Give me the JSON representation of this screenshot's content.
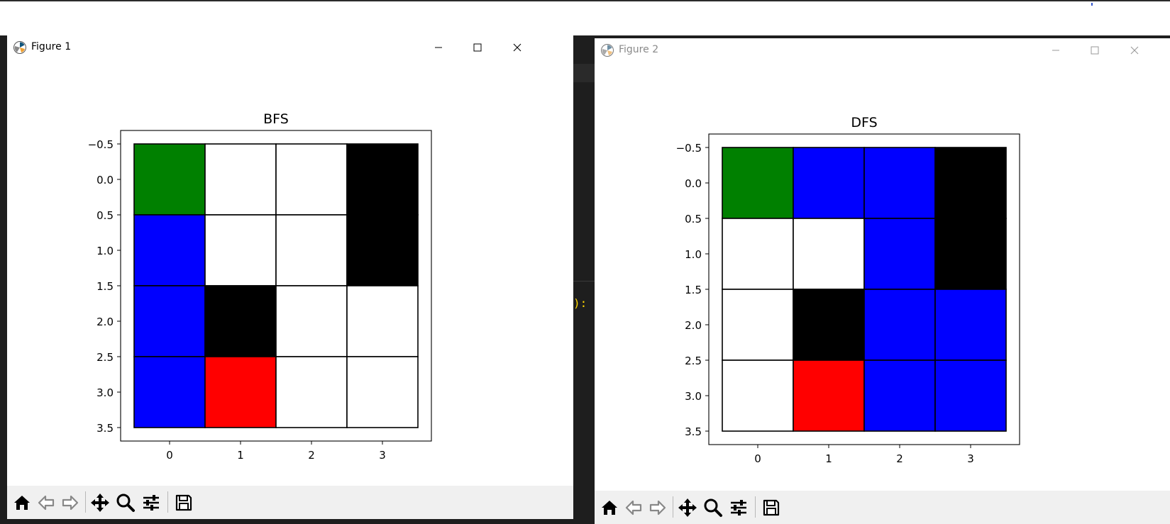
{
  "colors": {
    "start": "#008000",
    "visited": "#0000ff",
    "wall": "#000000",
    "goal": "#ff0000",
    "empty": "#ffffff"
  },
  "editor": {
    "code_fragment": "):"
  },
  "windows": [
    {
      "title": "Figure 1",
      "title_color": "#000000",
      "toolbar_buttons": [
        {
          "icon": "home-icon",
          "label": "Home"
        },
        {
          "icon": "back-arrow-icon",
          "label": "Back"
        },
        {
          "icon": "forward-arrow-icon",
          "label": "Forward"
        },
        {
          "icon": "pan-icon",
          "label": "Pan"
        },
        {
          "icon": "zoom-icon",
          "label": "Zoom"
        },
        {
          "icon": "configure-subplots-icon",
          "label": "Configure subplots"
        },
        {
          "icon": "save-icon",
          "label": "Save"
        }
      ],
      "chart_data": {
        "type": "heatmap",
        "title": "BFS",
        "xlabel": "",
        "ylabel": "",
        "x_ticks": [
          "0",
          "1",
          "2",
          "3"
        ],
        "y_ticks": [
          "−0.5",
          "0.0",
          "0.5",
          "1.0",
          "1.5",
          "2.0",
          "2.5",
          "3.0",
          "3.5"
        ],
        "xlim": [
          -0.5,
          3.5
        ],
        "ylim": [
          3.5,
          -0.5
        ],
        "grid": [
          [
            "start",
            "empty",
            "empty",
            "wall"
          ],
          [
            "visited",
            "empty",
            "empty",
            "wall"
          ],
          [
            "visited",
            "wall",
            "empty",
            "empty"
          ],
          [
            "visited",
            "goal",
            "empty",
            "empty"
          ]
        ]
      }
    },
    {
      "title": "Figure 2",
      "title_color": "#8a8a8a",
      "toolbar_buttons": [
        {
          "icon": "home-icon",
          "label": "Home"
        },
        {
          "icon": "back-arrow-icon",
          "label": "Back"
        },
        {
          "icon": "forward-arrow-icon",
          "label": "Forward"
        },
        {
          "icon": "pan-icon",
          "label": "Pan"
        },
        {
          "icon": "zoom-icon",
          "label": "Zoom"
        },
        {
          "icon": "configure-subplots-icon",
          "label": "Configure subplots"
        },
        {
          "icon": "save-icon",
          "label": "Save"
        }
      ],
      "chart_data": {
        "type": "heatmap",
        "title": "DFS",
        "xlabel": "",
        "ylabel": "",
        "x_ticks": [
          "0",
          "1",
          "2",
          "3"
        ],
        "y_ticks": [
          "−0.5",
          "0.0",
          "0.5",
          "1.0",
          "1.5",
          "2.0",
          "2.5",
          "3.0",
          "3.5"
        ],
        "xlim": [
          -0.5,
          3.5
        ],
        "ylim": [
          3.5,
          -0.5
        ],
        "grid": [
          [
            "start",
            "visited",
            "visited",
            "wall"
          ],
          [
            "empty",
            "empty",
            "visited",
            "wall"
          ],
          [
            "empty",
            "wall",
            "visited",
            "visited"
          ],
          [
            "empty",
            "goal",
            "visited",
            "visited"
          ]
        ]
      }
    }
  ]
}
